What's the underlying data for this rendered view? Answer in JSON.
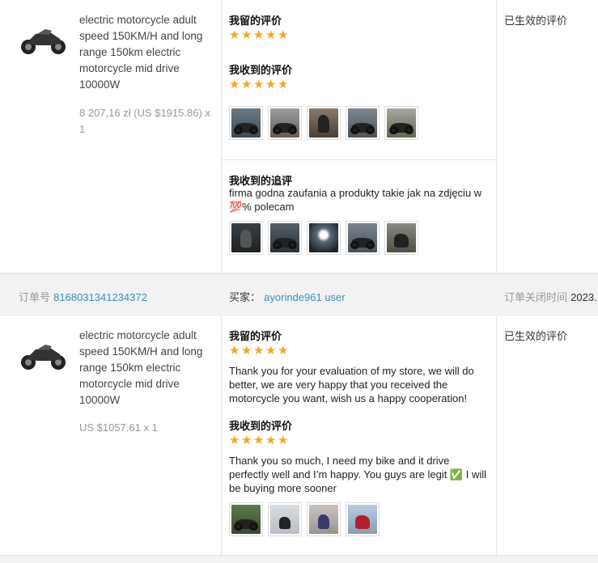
{
  "order1": {
    "product_title": "electric motorcycle adult speed 150KM/H and long range 150km electric motorcycle mid drive 10000W",
    "price": "8 207,16 zł (US $1915.86) x 1",
    "my_review_heading": "我留的评价",
    "my_review_rating": 5,
    "received_review_heading": "我收到的评价",
    "received_review_rating": 5,
    "status": "已生效的评价",
    "followup_heading": "我收到的追评",
    "followup_text": "firma godna zaufania a produkty takie jak na zdjęciu w 💯% polecam"
  },
  "order_bar": {
    "order_no_label": "订单号",
    "order_no": "8168031341234372",
    "buyer_label": "买家：",
    "buyer": "ayorinde961 user",
    "close_label": "订单关闭时间",
    "close_time": "2023."
  },
  "order2": {
    "product_title": "electric motorcycle adult speed 150KM/H and long range 150km electric motorcycle mid drive 10000W",
    "price": "US $1057.61 x 1",
    "my_review_heading": "我留的评价",
    "my_review_rating": 5,
    "my_review_text": "Thank you for your evaluation of my store, we will do better, we are very happy that you received the motorcycle you want, wish us a happy cooperation!",
    "received_review_heading": "我收到的评价",
    "received_review_rating": 5,
    "received_review_text": "Thank you so much, I need my bike and it drive perfectly well and I’m happy. You guys are legit ✅ I will be buying more sooner",
    "status": "已生效的评价"
  },
  "icons": {
    "star": "star-icon",
    "product": "motorcycle-thumbnail"
  },
  "colors": {
    "star": "#f5a623",
    "link": "#3a8fb7",
    "bar_bg": "#f2f2f2"
  }
}
